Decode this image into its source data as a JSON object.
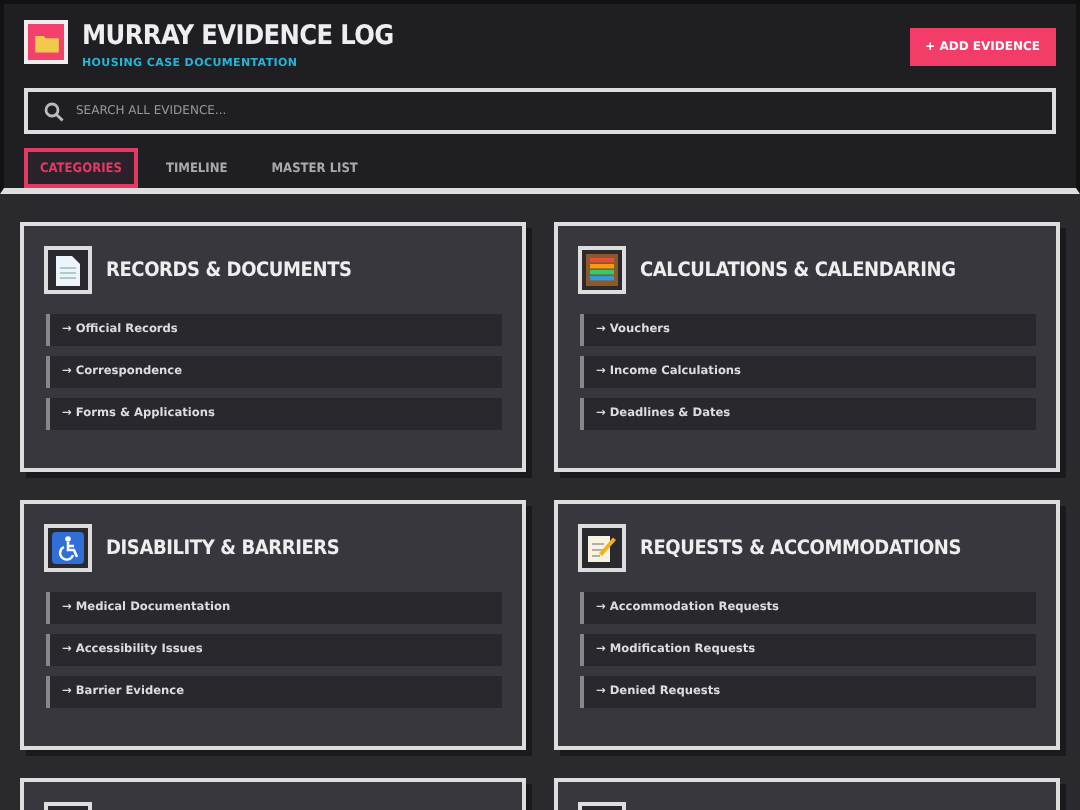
{
  "header": {
    "title": "MURRAY EVIDENCE LOG",
    "subtitle": "HOUSING CASE DOCUMENTATION",
    "add_button": "+ ADD EVIDENCE"
  },
  "search": {
    "placeholder": "SEARCH ALL EVIDENCE..."
  },
  "tabs": [
    {
      "label": "CATEGORIES",
      "selected": true
    },
    {
      "label": "TIMELINE",
      "selected": false
    },
    {
      "label": "MASTER LIST",
      "selected": false
    }
  ],
  "categories": [
    {
      "title": "RECORDS & DOCUMENTS",
      "items": [
        "→ Official Records",
        "→ Correspondence",
        "→ Forms & Applications"
      ]
    },
    {
      "title": "CALCULATIONS & CALENDARING",
      "items": [
        "→ Vouchers",
        "→ Income Calculations",
        "→ Deadlines & Dates"
      ]
    },
    {
      "title": "DISABILITY & BARRIERS",
      "items": [
        "→ Medical Documentation",
        "→ Accessibility Issues",
        "→ Barrier Evidence"
      ]
    },
    {
      "title": "REQUESTS & ACCOMMODATIONS",
      "items": [
        "→ Accommodation Requests",
        "→ Modification Requests",
        "→ Denied Requests"
      ]
    }
  ]
}
